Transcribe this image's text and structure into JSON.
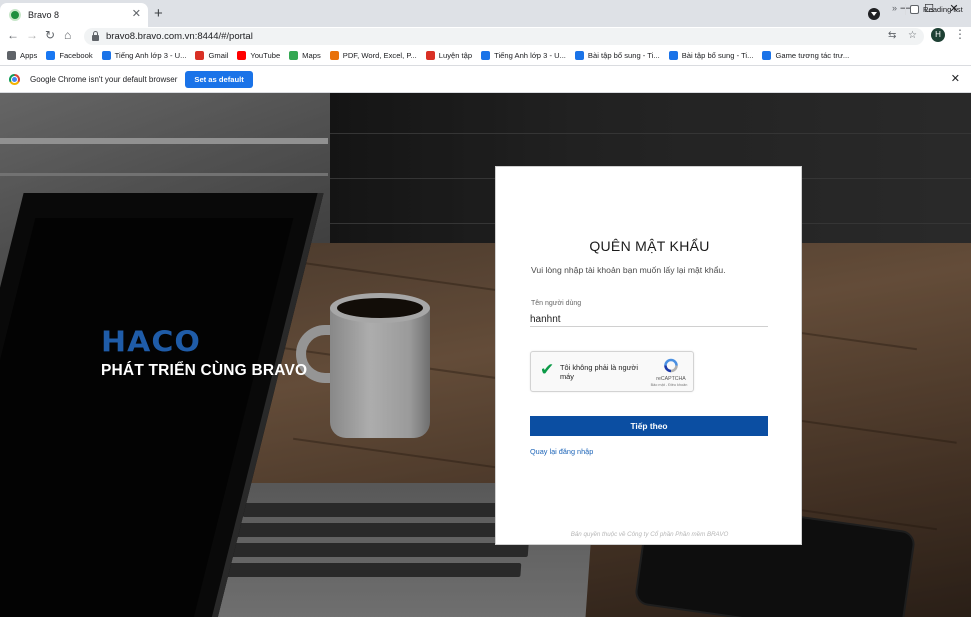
{
  "browser": {
    "tab_title": "Bravo 8",
    "url": "bravo8.bravo.com.vn:8444/#/portal",
    "profile_initial": "H",
    "bookmarks": [
      {
        "label": "Apps",
        "color": "#5f6368"
      },
      {
        "label": "Facebook",
        "color": "#1877f2"
      },
      {
        "label": "Tiếng Anh lớp 3 - U...",
        "color": "#1a73e8"
      },
      {
        "label": "Gmail",
        "color": "#d93025"
      },
      {
        "label": "YouTube",
        "color": "#ff0000"
      },
      {
        "label": "Maps",
        "color": "#34a853"
      },
      {
        "label": "PDF, Word, Excel, P...",
        "color": "#e8710a"
      },
      {
        "label": "Luyện tập",
        "color": "#d93025"
      },
      {
        "label": "Tiếng Anh lớp 3 - U...",
        "color": "#1a73e8"
      },
      {
        "label": "Bài tập bổ sung - Ti...",
        "color": "#1a73e8"
      },
      {
        "label": "Bài tập bổ sung - Ti...",
        "color": "#1a73e8"
      },
      {
        "label": "Game tương tác trư...",
        "color": "#1a73e8"
      }
    ],
    "reading_list": "Reading list",
    "infobar_text": "Google Chrome isn't your default browser",
    "infobar_button": "Set as default"
  },
  "brand": {
    "logo_text": "HACO",
    "slogan": "PHÁT TRIỂN CÙNG BRAVO",
    "logo_color": "#1f5ca8"
  },
  "form": {
    "title": "QUÊN MẬT KHẨU",
    "subtitle": "Vui lòng nhập tài khoản bạn muốn lấy lại mật khẩu.",
    "username_label": "Tên người dùng",
    "username_value": "hanhnt",
    "captcha_text": "Tôi không phải là người máy",
    "captcha_brand": "reCAPTCHA",
    "captcha_links": "Bảo mật - Điều khoản",
    "submit_label": "Tiếp theo",
    "back_link": "Quay lại đăng nhập",
    "copyright": "Bản quyền thuộc về Công ty Cổ phần Phần mềm BRAVO",
    "accent_color": "#0b4ea2"
  }
}
